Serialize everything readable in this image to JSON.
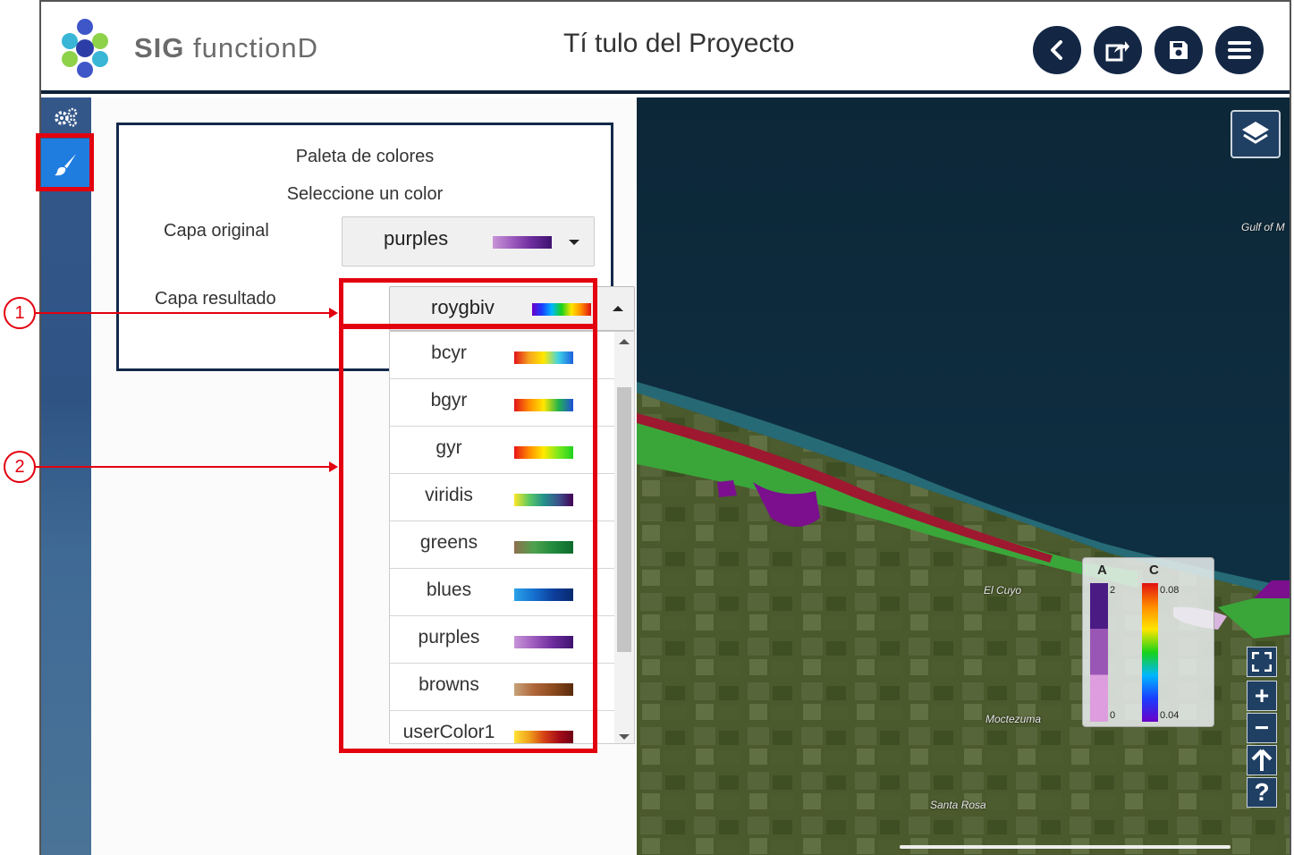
{
  "header": {
    "app_name_bold": "SIG",
    "app_name_rest": " functionD",
    "project_title": "Tí tulo del Proyecto",
    "buttons": [
      "back-icon",
      "share-icon",
      "save-icon",
      "menu-icon"
    ]
  },
  "sidebar": {
    "items": [
      {
        "icon": "settings-gears-icon"
      },
      {
        "icon": "paintbrush-icon",
        "active": true
      }
    ]
  },
  "panel": {
    "title": "Paleta de colores",
    "subtitle": "Seleccione un color",
    "original_label": "Capa original",
    "original_value": "purples",
    "result_label": "Capa resultado",
    "result_value": "roygbiv",
    "options": [
      {
        "label": "bcyr",
        "colors": "#e1141a,#f6a31f,#ffe800,#3fd3e5,#1d5fe0"
      },
      {
        "label": "bgyr",
        "colors": "#e1141a,#ff8d00,#ffe800,#22b34c,#1e4fd9"
      },
      {
        "label": "gyr",
        "colors": "#e81417,#ff8a00,#ffea00,#7ae81c,#1ed21e"
      },
      {
        "label": "viridis",
        "colors": "#fde725,#5ec962,#21918c,#3b528b,#440154"
      },
      {
        "label": "greens",
        "colors": "#8f6f4f,#4ea24e,#1f8a3d,#0e6b2c"
      },
      {
        "label": "blues",
        "colors": "#2aa1e8,#1570cf,#0d3e9c,#082a70"
      },
      {
        "label": "purples",
        "colors": "#c895d8,#9d5bbd,#6a2b9b,#3f136f"
      },
      {
        "label": "browns",
        "colors": "#c8a27a,#b0663a,#8b4a1c,#5a2a0d"
      },
      {
        "label": "userColor1",
        "colors": "#ffe135,#f0a21c,#d64315,#a80d17,#6f0014"
      }
    ]
  },
  "map": {
    "labels": [
      "Gulf of M",
      "El Cuyo",
      "Moctezuma",
      "Santa Rosa"
    ],
    "legend": {
      "a_title": "A",
      "a_max": "2",
      "a_min": "0",
      "c_title": "C",
      "c_max": "0.08",
      "c_min": "0.04"
    },
    "controls": [
      "fullscreen-icon",
      "zoom-in-icon",
      "zoom-out-icon",
      "north-arrow-icon",
      "help-icon"
    ]
  },
  "annotations": {
    "callout_1": "1",
    "callout_2": "2"
  },
  "colors": {
    "accent_red": "#e3000f",
    "navy": "#132745",
    "active_tab": "#1f7de0"
  }
}
